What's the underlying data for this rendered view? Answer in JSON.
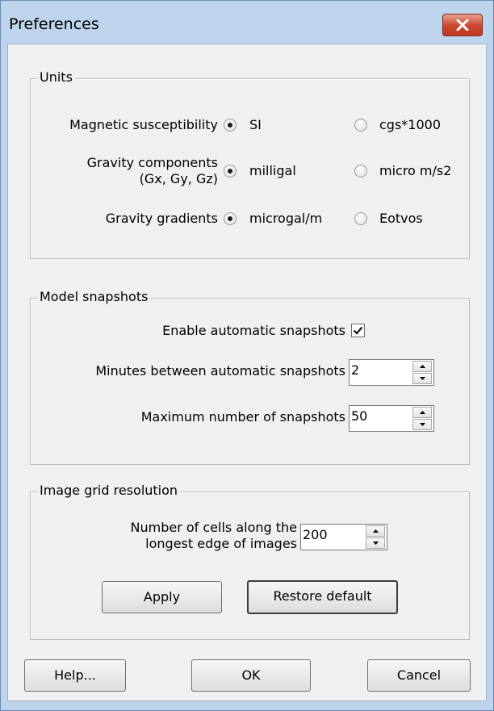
{
  "window": {
    "title": "Preferences"
  },
  "units": {
    "group_label": "Units",
    "magnetic": {
      "label": "Magnetic susceptibility",
      "options": [
        "SI",
        "cgs*1000"
      ],
      "selected": "SI"
    },
    "gravity_components": {
      "label_line1": "Gravity components",
      "label_line2": "(Gx, Gy, Gz)",
      "options": [
        "milligal",
        "micro m/s2"
      ],
      "selected": "milligal"
    },
    "gravity_gradients": {
      "label": "Gravity gradients",
      "options": [
        "microgal/m",
        "Eotvos"
      ],
      "selected": "microgal/m"
    }
  },
  "snapshots": {
    "group_label": "Model snapshots",
    "enable_label": "Enable automatic snapshots",
    "enable_checked": true,
    "minutes_label": "Minutes between automatic snapshots",
    "minutes_value": "2",
    "maximum_label": "Maximum number of snapshots",
    "maximum_value": "50"
  },
  "image_grid": {
    "group_label": "Image grid resolution",
    "cells_label_line1": "Number of cells along the",
    "cells_label_line2": "longest edge of images",
    "cells_value": "200",
    "apply_label": "Apply",
    "restore_label": "Restore default"
  },
  "footer": {
    "help_label": "Help...",
    "ok_label": "OK",
    "cancel_label": "Cancel"
  },
  "colors": {
    "frame": "#bdd4ec",
    "client": "#f0f0f0",
    "close_button": "#c9452d"
  },
  "icons": {
    "close": "close-icon",
    "spin_up": "chevron-up-icon",
    "spin_down": "chevron-down-icon",
    "check": "check-icon"
  }
}
